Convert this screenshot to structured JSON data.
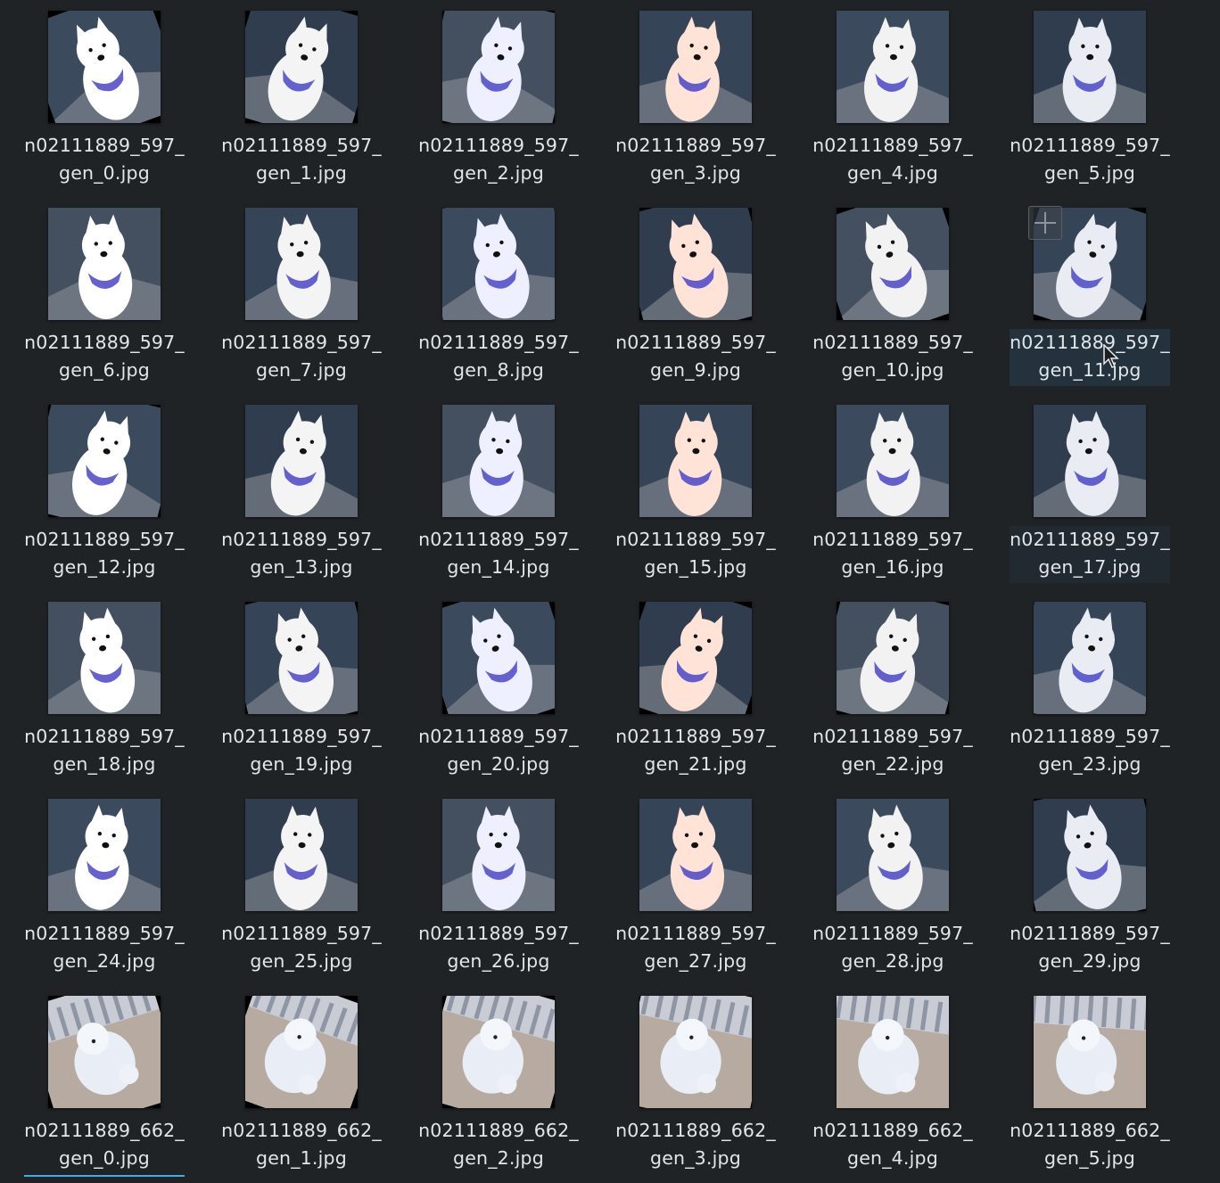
{
  "view": {
    "selected_file": "n02111889_597_gen_11.jpg",
    "hovered_file": "n02111889_597_gen_17.jpg",
    "focused_file": "n02111889_662_gen_0.jpg"
  },
  "files": [
    {
      "line1": "n02111889_597_",
      "line2": "gen_0.jpg"
    },
    {
      "line1": "n02111889_597_",
      "line2": "gen_1.jpg"
    },
    {
      "line1": "n02111889_597_",
      "line2": "gen_2.jpg"
    },
    {
      "line1": "n02111889_597_",
      "line2": "gen_3.jpg"
    },
    {
      "line1": "n02111889_597_",
      "line2": "gen_4.jpg"
    },
    {
      "line1": "n02111889_597_",
      "line2": "gen_5.jpg"
    },
    {
      "line1": "n02111889_597_",
      "line2": "gen_6.jpg"
    },
    {
      "line1": "n02111889_597_",
      "line2": "gen_7.jpg"
    },
    {
      "line1": "n02111889_597_",
      "line2": "gen_8.jpg"
    },
    {
      "line1": "n02111889_597_",
      "line2": "gen_9.jpg"
    },
    {
      "line1": "n02111889_597_",
      "line2": "gen_10.jpg"
    },
    {
      "line1": "n02111889_597_",
      "line2": "gen_11.jpg"
    },
    {
      "line1": "n02111889_597_",
      "line2": "gen_12.jpg"
    },
    {
      "line1": "n02111889_597_",
      "line2": "gen_13.jpg"
    },
    {
      "line1": "n02111889_597_",
      "line2": "gen_14.jpg"
    },
    {
      "line1": "n02111889_597_",
      "line2": "gen_15.jpg"
    },
    {
      "line1": "n02111889_597_",
      "line2": "gen_16.jpg"
    },
    {
      "line1": "n02111889_597_",
      "line2": "gen_17.jpg"
    },
    {
      "line1": "n02111889_597_",
      "line2": "gen_18.jpg"
    },
    {
      "line1": "n02111889_597_",
      "line2": "gen_19.jpg"
    },
    {
      "line1": "n02111889_597_",
      "line2": "gen_20.jpg"
    },
    {
      "line1": "n02111889_597_",
      "line2": "gen_21.jpg"
    },
    {
      "line1": "n02111889_597_",
      "line2": "gen_22.jpg"
    },
    {
      "line1": "n02111889_597_",
      "line2": "gen_23.jpg"
    },
    {
      "line1": "n02111889_597_",
      "line2": "gen_24.jpg"
    },
    {
      "line1": "n02111889_597_",
      "line2": "gen_25.jpg"
    },
    {
      "line1": "n02111889_597_",
      "line2": "gen_26.jpg"
    },
    {
      "line1": "n02111889_597_",
      "line2": "gen_27.jpg"
    },
    {
      "line1": "n02111889_597_",
      "line2": "gen_28.jpg"
    },
    {
      "line1": "n02111889_597_",
      "line2": "gen_29.jpg"
    },
    {
      "line1": "n02111889_662_",
      "line2": "gen_0.jpg"
    },
    {
      "line1": "n02111889_662_",
      "line2": "gen_1.jpg"
    },
    {
      "line1": "n02111889_662_",
      "line2": "gen_2.jpg"
    },
    {
      "line1": "n02111889_662_",
      "line2": "gen_3.jpg"
    },
    {
      "line1": "n02111889_662_",
      "line2": "gen_4.jpg"
    },
    {
      "line1": "n02111889_662_",
      "line2": "gen_5.jpg"
    }
  ],
  "colors": {
    "background": "#202326",
    "text": "#e3e6e8",
    "selection": "#23323c",
    "focus_underline": "#3daee9"
  },
  "icons": {
    "selection_toggle": "plus-icon",
    "pointer": "mouse-cursor-icon"
  }
}
